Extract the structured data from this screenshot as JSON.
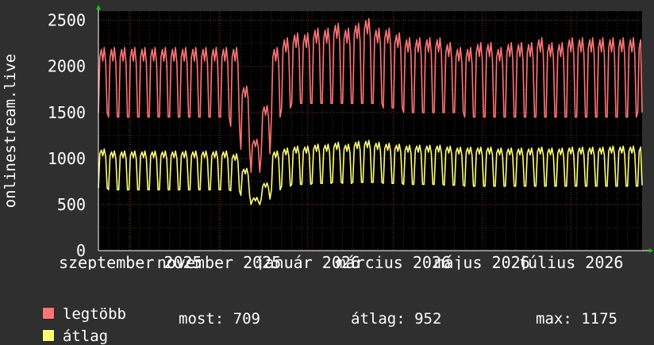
{
  "chart_data": {
    "type": "line",
    "ylabel": "onlinestream.live",
    "ylim": [
      0,
      2600
    ],
    "y_ticks": [
      0,
      500,
      1000,
      1500,
      2000,
      2500
    ],
    "x_tick_labels": [
      "szeptember 2025",
      "november 2025",
      "január 2026",
      "március 2026",
      "május 2026",
      "július 2026"
    ],
    "x_range": [
      "2025-08-10",
      "2026-08-19"
    ],
    "grid": true,
    "background_color": "#000000",
    "grid_color": "#883333",
    "series": [
      {
        "name": "legtöbb",
        "color": "#ff7575",
        "weekday_level": [
          2100,
          2100,
          2100,
          2100,
          2100,
          2100,
          2100,
          2100,
          2100,
          2100,
          2100,
          2100,
          2100,
          2100,
          1700,
          1150,
          1500,
          2100,
          2200,
          2250,
          2250,
          2300,
          2300,
          2350,
          2300,
          2350,
          2400,
          2300,
          2300,
          2250,
          2200,
          2200,
          2200,
          2200,
          2150,
          2100,
          2100,
          2150,
          2150,
          2100,
          2150,
          2150,
          2150,
          2200,
          2150,
          2150,
          2200,
          2200,
          2200,
          2200,
          2200,
          2200,
          2200,
          2200
        ],
        "weekend_level": [
          1500,
          1450,
          1450,
          1450,
          1450,
          1450,
          1450,
          1450,
          1450,
          1450,
          1450,
          1450,
          1450,
          1350,
          1100,
          850,
          1050,
          1450,
          1550,
          1600,
          1600,
          1600,
          1600,
          1600,
          1600,
          1600,
          1600,
          1600,
          1550,
          1550,
          1500,
          1500,
          1500,
          1500,
          1500,
          1500,
          1450,
          1450,
          1450,
          1450,
          1450,
          1450,
          1450,
          1450,
          1450,
          1450,
          1450,
          1450,
          1450,
          1450,
          1450,
          1450,
          1450,
          1500
        ],
        "last_value": 1500
      },
      {
        "name": "átlag",
        "color": "#ffff75",
        "weekday_level": [
          1050,
          1030,
          1030,
          1030,
          1030,
          1030,
          1030,
          1030,
          1030,
          1030,
          1030,
          1030,
          1030,
          1000,
          850,
          550,
          700,
          1030,
          1060,
          1080,
          1080,
          1100,
          1100,
          1120,
          1100,
          1130,
          1140,
          1120,
          1110,
          1100,
          1090,
          1090,
          1090,
          1090,
          1080,
          1070,
          1070,
          1070,
          1070,
          1060,
          1060,
          1060,
          1060,
          1070,
          1060,
          1060,
          1070,
          1070,
          1070,
          1070,
          1080,
          1080,
          1080,
          1080
        ],
        "weekend_level": [
          680,
          660,
          660,
          660,
          660,
          660,
          660,
          660,
          660,
          660,
          660,
          660,
          660,
          650,
          600,
          500,
          560,
          660,
          700,
          720,
          720,
          730,
          730,
          740,
          730,
          740,
          740,
          740,
          730,
          730,
          720,
          720,
          720,
          720,
          710,
          710,
          700,
          700,
          700,
          700,
          700,
          700,
          700,
          700,
          700,
          700,
          700,
          700,
          700,
          700,
          700,
          700,
          700,
          700
        ],
        "last_value": 709
      }
    ]
  },
  "legend": {
    "max_label": "legtöbb",
    "avg_label": "átlag"
  },
  "stats": {
    "now": "most: 709",
    "average": "átlag: 952",
    "max": "max: 1175"
  }
}
